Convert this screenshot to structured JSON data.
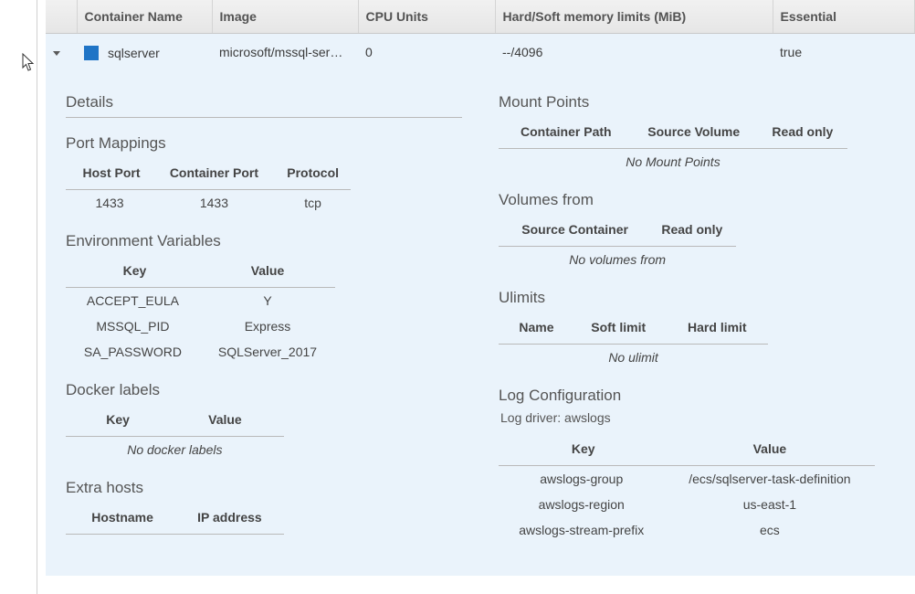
{
  "grid": {
    "columns": [
      "Container Name",
      "Image",
      "CPU Units",
      "Hard/Soft memory limits (MiB)",
      "Essential"
    ],
    "row": {
      "name": "sqlserver",
      "image": "microsoft/mssql-ser…",
      "cpu": "0",
      "memory": "--/4096",
      "essential": "true"
    }
  },
  "left": {
    "details_title": "Details",
    "port_mappings": {
      "title": "Port Mappings",
      "cols": [
        "Host Port",
        "Container Port",
        "Protocol"
      ],
      "rows": [
        [
          "1433",
          "1433",
          "tcp"
        ]
      ]
    },
    "env": {
      "title": "Environment Variables",
      "cols": [
        "Key",
        "Value"
      ],
      "rows": [
        [
          "ACCEPT_EULA",
          "Y"
        ],
        [
          "MSSQL_PID",
          "Express"
        ],
        [
          "SA_PASSWORD",
          "SQLServer_2017"
        ]
      ]
    },
    "labels": {
      "title": "Docker labels",
      "cols": [
        "Key",
        "Value"
      ],
      "empty": "No docker labels"
    },
    "hosts": {
      "title": "Extra hosts",
      "cols": [
        "Hostname",
        "IP address"
      ]
    }
  },
  "right": {
    "mounts": {
      "title": "Mount Points",
      "cols": [
        "Container Path",
        "Source Volume",
        "Read only"
      ],
      "empty": "No Mount Points"
    },
    "volumes": {
      "title": "Volumes from",
      "cols": [
        "Source Container",
        "Read only"
      ],
      "empty": "No volumes from"
    },
    "ulimits": {
      "title": "Ulimits",
      "cols": [
        "Name",
        "Soft limit",
        "Hard limit"
      ],
      "empty": "No ulimit"
    },
    "log": {
      "title": "Log Configuration",
      "driver_label": "Log driver:",
      "driver": "awslogs",
      "cols": [
        "Key",
        "Value"
      ],
      "rows": [
        [
          "awslogs-group",
          "/ecs/sqlserver-task-definition"
        ],
        [
          "awslogs-region",
          "us-east-1"
        ],
        [
          "awslogs-stream-prefix",
          "ecs"
        ]
      ]
    }
  }
}
